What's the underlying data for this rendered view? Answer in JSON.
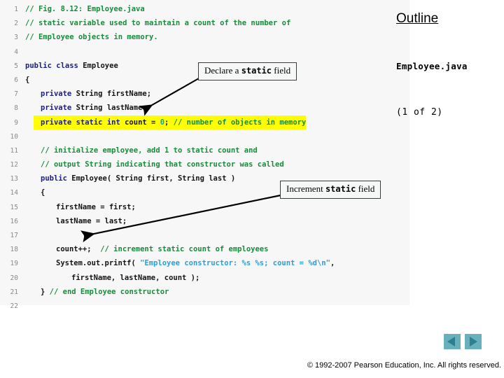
{
  "slide": {
    "outline": {
      "title": "Outline",
      "filename": "Employee.java",
      "page_info": "(1 of  2)"
    },
    "footer": {
      "copyright": "© 1992-2007 Pearson Education, Inc.  All rights reserved."
    },
    "nav": {
      "prev_label": "Previous slide",
      "next_label": "Next slide"
    },
    "callouts": [
      {
        "id": "declare",
        "prefix": "Declare a ",
        "mono": "static",
        "suffix": " field"
      },
      {
        "id": "increment",
        "prefix": "Increment ",
        "mono": "static",
        "suffix": " field"
      }
    ],
    "code": {
      "language": "java",
      "highlight_color": "#ffff00",
      "lines": [
        {
          "n": "1",
          "indent": 0,
          "highlighted": false,
          "tokens": [
            {
              "t": "// Fig. 8.12: Employee.java",
              "c": "cm"
            }
          ]
        },
        {
          "n": "2",
          "indent": 0,
          "highlighted": false,
          "tokens": [
            {
              "t": "// static variable used to maintain a count of the number of",
              "c": "cm"
            }
          ]
        },
        {
          "n": "3",
          "indent": 0,
          "highlighted": false,
          "tokens": [
            {
              "t": "// Employee objects in memory.",
              "c": "cm"
            }
          ]
        },
        {
          "n": "4",
          "indent": 0,
          "highlighted": false,
          "tokens": [
            {
              "t": "",
              "c": "pl"
            }
          ]
        },
        {
          "n": "5",
          "indent": 0,
          "highlighted": false,
          "tokens": [
            {
              "t": "public class ",
              "c": "kw"
            },
            {
              "t": "Employee",
              "c": "pl"
            }
          ]
        },
        {
          "n": "6",
          "indent": 0,
          "highlighted": false,
          "tokens": [
            {
              "t": "{",
              "c": "pl"
            }
          ]
        },
        {
          "n": "7",
          "indent": 1,
          "highlighted": false,
          "tokens": [
            {
              "t": "private ",
              "c": "kw"
            },
            {
              "t": "String firstName;",
              "c": "pl"
            }
          ]
        },
        {
          "n": "8",
          "indent": 1,
          "highlighted": false,
          "tokens": [
            {
              "t": "private ",
              "c": "kw"
            },
            {
              "t": "String lastName;",
              "c": "pl"
            }
          ]
        },
        {
          "n": "9",
          "indent": 1,
          "highlighted": true,
          "tokens": [
            {
              "t": "private static int ",
              "c": "kw"
            },
            {
              "t": "count = ",
              "c": "pl"
            },
            {
              "t": "0",
              "c": "nm"
            },
            {
              "t": "; ",
              "c": "pl"
            },
            {
              "t": "// number of objects in memory",
              "c": "cm"
            }
          ]
        },
        {
          "n": "10",
          "indent": 0,
          "highlighted": false,
          "tokens": [
            {
              "t": "",
              "c": "pl"
            }
          ]
        },
        {
          "n": "11",
          "indent": 1,
          "highlighted": false,
          "tokens": [
            {
              "t": "// initialize employee, add 1 to static count and",
              "c": "cm"
            }
          ]
        },
        {
          "n": "12",
          "indent": 1,
          "highlighted": false,
          "tokens": [
            {
              "t": "// output String indicating that constructor was called",
              "c": "cm"
            }
          ]
        },
        {
          "n": "13",
          "indent": 1,
          "highlighted": false,
          "tokens": [
            {
              "t": "public ",
              "c": "kw"
            },
            {
              "t": "Employee( String first, String last )",
              "c": "pl"
            }
          ]
        },
        {
          "n": "14",
          "indent": 1,
          "highlighted": false,
          "tokens": [
            {
              "t": "{",
              "c": "pl"
            }
          ]
        },
        {
          "n": "15",
          "indent": 2,
          "highlighted": false,
          "tokens": [
            {
              "t": "firstName = first;",
              "c": "pl"
            }
          ]
        },
        {
          "n": "16",
          "indent": 2,
          "highlighted": false,
          "tokens": [
            {
              "t": "lastName = last;",
              "c": "pl"
            }
          ]
        },
        {
          "n": "17",
          "indent": 0,
          "highlighted": false,
          "tokens": [
            {
              "t": "",
              "c": "pl"
            }
          ]
        },
        {
          "n": "18",
          "indent": 2,
          "highlighted": false,
          "tokens": [
            {
              "t": "count++;  ",
              "c": "pl"
            },
            {
              "t": "// increment static count of employees",
              "c": "cm"
            }
          ]
        },
        {
          "n": "19",
          "indent": 2,
          "highlighted": false,
          "tokens": [
            {
              "t": "System.out.printf( ",
              "c": "pl"
            },
            {
              "t": "\"Employee constructor: %s %s; count = %d\\n\"",
              "c": "st"
            },
            {
              "t": ",",
              "c": "pl"
            }
          ]
        },
        {
          "n": "20",
          "indent": 3,
          "highlighted": false,
          "tokens": [
            {
              "t": "firstName, lastName, count );",
              "c": "pl"
            }
          ]
        },
        {
          "n": "21",
          "indent": 1,
          "highlighted": false,
          "tokens": [
            {
              "t": "} ",
              "c": "pl"
            },
            {
              "t": "// end Employee constructor",
              "c": "cm"
            }
          ]
        },
        {
          "n": "22",
          "indent": 0,
          "highlighted": false,
          "tokens": [
            {
              "t": "",
              "c": "pl"
            }
          ]
        }
      ]
    }
  }
}
